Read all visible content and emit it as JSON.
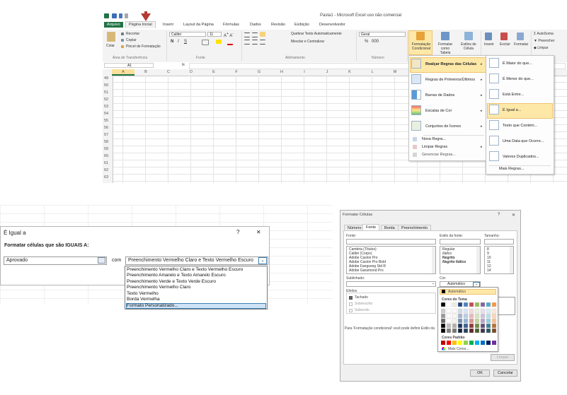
{
  "excel": {
    "title": "Pasta1 - Microsoft Excel uso não comercial",
    "tabs": [
      "Arquivo",
      "Página Inicial",
      "Inserir",
      "Layout da Página",
      "Fórmulas",
      "Dados",
      "Revisão",
      "Exibição",
      "Desenvolvedor"
    ],
    "clipboard": {
      "paste": "Colar",
      "cut": "Recortar",
      "copy": "Copiar",
      "painter": "Pincel de Formatação",
      "group": "Área de Transferência"
    },
    "font": {
      "name": "Calibri",
      "size": "11",
      "group": "Fonte",
      "bold": "N",
      "italic": "I",
      "underline": "S"
    },
    "alignment": {
      "wrap": "Quebrar Texto Automaticamente",
      "merge": "Mesclar e Centralizar",
      "group": "Alinhamento"
    },
    "number": {
      "format": "Geral",
      "group": "Número",
      "percent": "%",
      "thousands": "000"
    },
    "styles": {
      "conditional": "Formatação Condicional",
      "table": "Formatar como Tabela",
      "cell": "Estilos de Célula"
    },
    "cells": {
      "insert": "Inserir",
      "delete": "Excluir",
      "format": "Formatar"
    },
    "editing": {
      "autosum": "AutoSoma",
      "fill": "Preencher",
      "clear": "Limpar"
    },
    "namebox": "A1",
    "fx": "fx",
    "columns": [
      "A",
      "B",
      "C",
      "D",
      "E",
      "F",
      "G",
      "H",
      "I",
      "J",
      "K",
      "L",
      "M"
    ],
    "rows": [
      "49",
      "50",
      "51",
      "52",
      "53",
      "54",
      "55",
      "56",
      "57",
      "58",
      "59",
      "60",
      "61",
      "62",
      "63"
    ],
    "cf_menu": {
      "items": [
        "Realçar Regras das Células",
        "Regras de Primeiros/Últimos",
        "Barras de Dados",
        "Escalas de Cor",
        "Conjuntos de Ícones"
      ],
      "actions": [
        "Nova Regra...",
        "Limpar Regras",
        "Gerenciar Regras..."
      ]
    },
    "sub_menu": {
      "items": [
        "É Maior do que...",
        "É Menor do que...",
        "Está Entre...",
        "É Igual a...",
        "Texto que Contém...",
        "Uma Data que Ocorre...",
        "Valores Duplicados..."
      ],
      "more": "Mais Regras..."
    }
  },
  "dialog_equal": {
    "title": "É Igual a",
    "help": "?",
    "close": "✕",
    "heading": "Formatar células que são IGUAIS A:",
    "value": "Aprovado",
    "with": "com",
    "selected": "Preenchimento Vermelho Claro e Texto Vermelho Escuro",
    "options": [
      "Preenchimento Vermelho Claro e Texto Vermelho Escuro",
      "Preenchimento Amarelo e Texto Amarelo Escuro",
      "Preenchimento Verde e Texto Verde Escuro",
      "Preenchimento Vermelho Claro",
      "Texto Vermelho",
      "Borda Vermelha",
      "Formato Personalizado..."
    ]
  },
  "dialog_format": {
    "title": "Formatar Células",
    "help": "?",
    "close": "✕",
    "tabs": [
      "Número",
      "Fonte",
      "Borda",
      "Preenchimento"
    ],
    "font_label": "Fonte:",
    "style_label": "Estilo da fonte:",
    "size_label": "Tamanho:",
    "fonts": [
      "Cambria (Títulos)",
      "Calibri (Corpo)",
      "Adobe Caslon Pro",
      "Adobe Caslon Pro Bold",
      "Adobe Fangsong Std R",
      "Adobe Garamond Pro"
    ],
    "styles": [
      "Regular",
      "Itálico",
      "Negrito",
      "Negrito Itálico"
    ],
    "sizes": [
      "8",
      "9",
      "10",
      "11",
      "12",
      "14"
    ],
    "underline_label": "Sublinhado:",
    "color_label": "Cor:",
    "color_value": "Automático",
    "effects_label": "Efeitos",
    "effects": [
      "Tachado",
      "Sobrescrito",
      "Subscrito"
    ],
    "note": "Para 'Formatação condicional' você pode definir Estilo da",
    "clear": "Limpar",
    "ok": "OK",
    "cancel": "Cancelar",
    "palette": {
      "auto": "Automático",
      "theme_label": "Cores do Tema",
      "standard_label": "Cores Padrão",
      "more": "Mais Cores...",
      "theme_top": [
        "#000000",
        "#ffffff",
        "#eeece1",
        "#1f497d",
        "#4f81bd",
        "#c0504d",
        "#9bbb59",
        "#8064a2",
        "#4bacc6",
        "#f79646"
      ],
      "standard": [
        "#c00000",
        "#ff0000",
        "#ffc000",
        "#ffff00",
        "#92d050",
        "#00b050",
        "#00b0f0",
        "#0070c0",
        "#002060",
        "#7030a0"
      ]
    }
  },
  "colors": {
    "excel_green": "#217346",
    "arrow": "#b53a32",
    "highlight": "#fde8a8"
  }
}
